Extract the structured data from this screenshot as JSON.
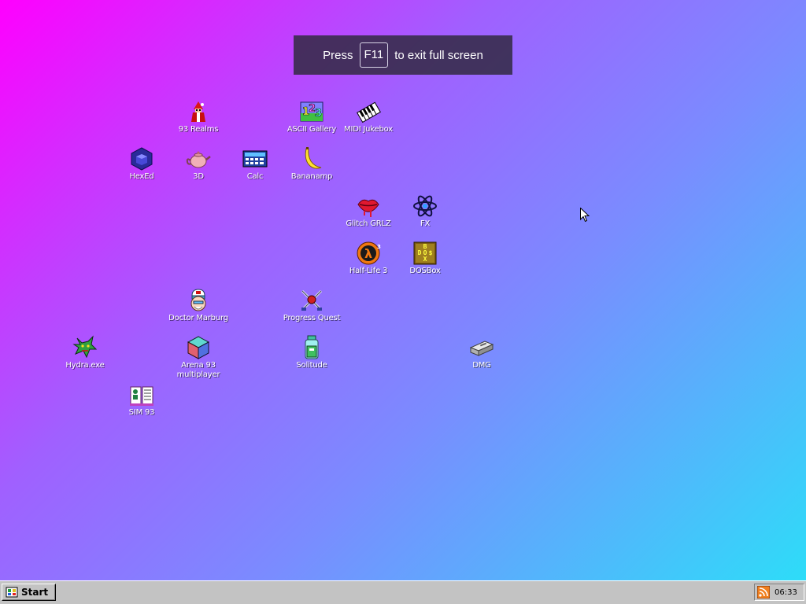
{
  "fullscreen_notice": {
    "press": "Press",
    "key": "F11",
    "suffix": "to exit full screen"
  },
  "desktop": {
    "icons": [
      {
        "label": "93 Realms",
        "icon": "red-mage-icon"
      },
      {
        "label": "ASCII Gallery",
        "icon": "ascii-123-icon"
      },
      {
        "label": "MIDI Jukebox",
        "icon": "piano-keys-icon"
      },
      {
        "label": "HexEd",
        "icon": "blue-cube-icon"
      },
      {
        "label": "3D",
        "icon": "teapot-icon"
      },
      {
        "label": "Calc",
        "icon": "calculator-icon"
      },
      {
        "label": "Bananamp",
        "icon": "banana-icon"
      },
      {
        "label": "Glitch GRLZ",
        "icon": "lips-icon"
      },
      {
        "label": "FX",
        "icon": "atom-icon"
      },
      {
        "label": "Half-Life 3",
        "icon": "lambda-icon"
      },
      {
        "label": "DOSBox",
        "icon": "dosbox-icon"
      },
      {
        "label": "Doctor Marburg",
        "icon": "doctor-icon"
      },
      {
        "label": "Progress Quest",
        "icon": "crossed-swords-icon"
      },
      {
        "label": "Hydra.exe",
        "icon": "dragon-icon"
      },
      {
        "label": "Arena 93 multiplayer",
        "icon": "color-cube-icon"
      },
      {
        "label": "Solitude",
        "icon": "jar-icon"
      },
      {
        "label": "DMG",
        "icon": "disk-drive-icon"
      },
      {
        "label": "SIM 93",
        "icon": "open-book-icon"
      }
    ]
  },
  "taskbar": {
    "start_label": "Start",
    "clock": "06:33",
    "tray_icon": "rss-feed-icon"
  },
  "colors": {
    "gradient_top_left": "#ff00ff",
    "gradient_bottom_right": "#2ae0f8",
    "taskbar": "#c3c3c3"
  }
}
